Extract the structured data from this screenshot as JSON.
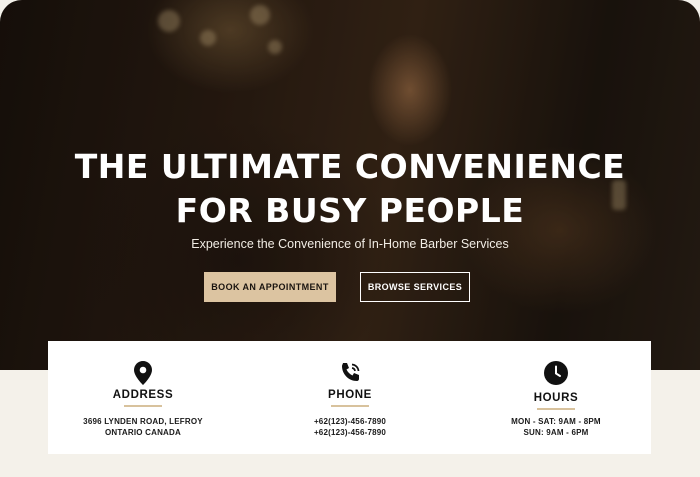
{
  "hero": {
    "title_line1": "THE ULTIMATE CONVENIENCE",
    "title_line2": "FOR BUSY PEOPLE",
    "subtitle": "Experience the Convenience of In-Home Barber Services",
    "book_label": "BOOK AN APPOINTMENT",
    "browse_label": "BROWSE SERVICES"
  },
  "info": {
    "address": {
      "icon": "map-pin-icon",
      "title": "ADDRESS",
      "line1": "3696 LYNDEN ROAD, LEFROY",
      "line2": "ONTARIO CANADA"
    },
    "phone": {
      "icon": "phone-icon",
      "title": "PHONE",
      "line1": "+62(123)-456-7890",
      "line2": "+62(123)-456-7890"
    },
    "hours": {
      "icon": "clock-icon",
      "title": "HOURS",
      "line1": "MON - SAT: 9AM - 8PM",
      "line2": "SUN: 9AM - 6PM"
    }
  },
  "colors": {
    "accent": "#dcc4a1",
    "divider": "#d8c29d",
    "page_bg": "#f4f1ea"
  }
}
